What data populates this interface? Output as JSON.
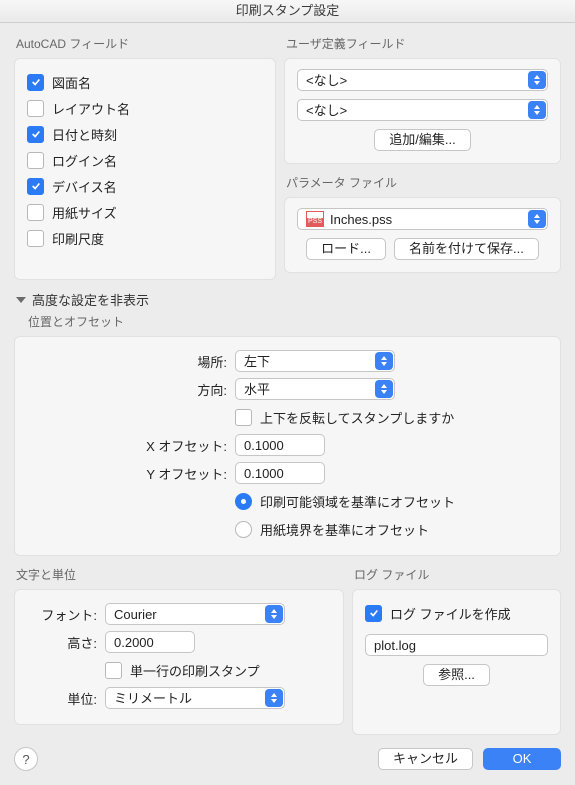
{
  "window": {
    "title": "印刷スタンプ設定"
  },
  "autocad_fields": {
    "title": "AutoCAD フィールド",
    "items": [
      {
        "label": "図面名",
        "checked": true
      },
      {
        "label": "レイアウト名",
        "checked": false
      },
      {
        "label": "日付と時刻",
        "checked": true
      },
      {
        "label": "ログイン名",
        "checked": false
      },
      {
        "label": "デバイス名",
        "checked": true
      },
      {
        "label": "用紙サイズ",
        "checked": false
      },
      {
        "label": "印刷尺度",
        "checked": false
      }
    ]
  },
  "user_fields": {
    "title": "ユーザ定義フィールド",
    "select1": "<なし>",
    "select2": "<なし>",
    "add_edit": "追加/編集..."
  },
  "param_file": {
    "title": "パラメータ ファイル",
    "filename": "Inches.pss",
    "load": "ロード...",
    "save_as": "名前を付けて保存..."
  },
  "advanced": {
    "toggle_label": "高度な設定を非表示",
    "position_title": "位置とオフセット",
    "location_label": "場所:",
    "location_value": "左下",
    "orientation_label": "方向:",
    "orientation_value": "水平",
    "flip_label": "上下を反転してスタンプしますか",
    "flip_checked": false,
    "x_offset_label": "X オフセット:",
    "x_offset_value": "0.1000",
    "y_offset_label": "Y オフセット:",
    "y_offset_value": "0.1000",
    "radio_printable": "印刷可能領域を基準にオフセット",
    "radio_paper": "用紙境界を基準にオフセット",
    "radio_selected": "printable"
  },
  "text_units": {
    "title": "文字と単位",
    "font_label": "フォント:",
    "font_value": "Courier",
    "height_label": "高さ:",
    "height_value": "0.2000",
    "single_line_label": "単一行の印刷スタンプ",
    "single_line_checked": false,
    "units_label": "単位:",
    "units_value": "ミリメートル"
  },
  "log_file": {
    "title": "ログ ファイル",
    "create_label": "ログ ファイルを作成",
    "create_checked": true,
    "filename": "plot.log",
    "browse": "参照..."
  },
  "footer": {
    "cancel": "キャンセル",
    "ok": "OK"
  }
}
